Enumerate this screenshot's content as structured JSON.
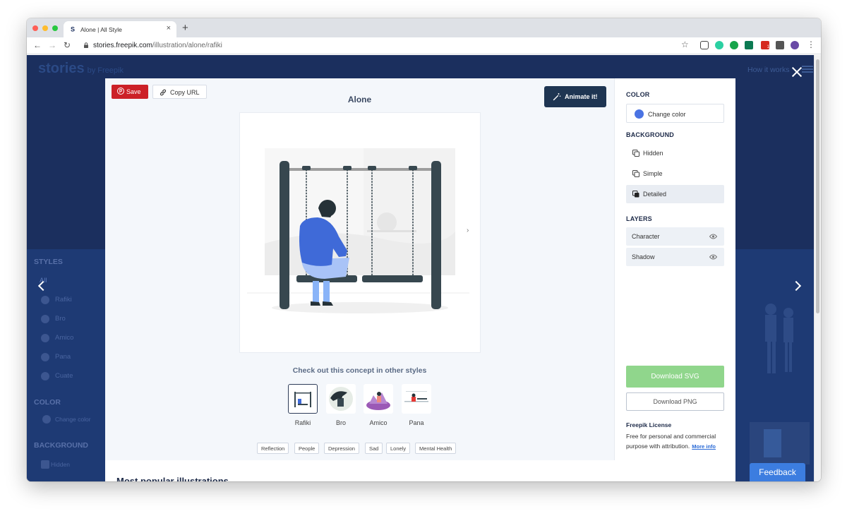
{
  "browser": {
    "tab_title": "Alone | All Style",
    "tab_close": "×",
    "new_tab": "+",
    "url_host": "stories.freepik.com",
    "url_path": "/illustration/alone/rafiki",
    "nav_back": "←",
    "nav_forward": "→",
    "nav_reload": "↻",
    "star": "☆",
    "menu": "⋮",
    "ext_badge": "1"
  },
  "site": {
    "logo": "stories",
    "logo_by": "by Freepik",
    "how_it_works": "How it works"
  },
  "sidebar_bg": {
    "styles_heading": "STYLES",
    "all": "All",
    "styles": [
      "Rafiki",
      "Bro",
      "Amico",
      "Pana",
      "Cuate"
    ],
    "color_heading": "COLOR",
    "change_color": "Change color",
    "background_heading": "BACKGROUND",
    "hidden": "Hidden"
  },
  "modal": {
    "save_label": "Save",
    "copy_url_label": "Copy URL",
    "title": "Alone",
    "animate_label": "Animate it!",
    "other_styles_heading": "Check out this concept in other styles",
    "styles": [
      {
        "label": "Rafiki",
        "selected": true
      },
      {
        "label": "Bro",
        "selected": false
      },
      {
        "label": "Amico",
        "selected": false
      },
      {
        "label": "Pana",
        "selected": false
      }
    ],
    "tags": [
      "Reflection",
      "People",
      "Depression",
      "Sad",
      "Lonely",
      "Mental Health"
    ],
    "bottom_heading": "Most popular illustrations"
  },
  "panel": {
    "color_heading": "COLOR",
    "change_color": "Change color",
    "color_swatch": "#4a73e3",
    "background_heading": "BACKGROUND",
    "background_options": [
      {
        "label": "Hidden",
        "selected": false
      },
      {
        "label": "Simple",
        "selected": false
      },
      {
        "label": "Detailed",
        "selected": true
      }
    ],
    "layers_heading": "LAYERS",
    "layers": [
      {
        "label": "Character",
        "icon": "eye-icon"
      },
      {
        "label": "Shadow",
        "icon": "eye-icon"
      }
    ],
    "download_svg": "Download SVG",
    "download_png": "Download PNG",
    "license_heading": "Freepik License",
    "license_text": "Free for personal and commercial purpose with attribution.",
    "more_info": "More info"
  },
  "feedback_label": "Feedback",
  "colors": {
    "save_red": "#cc2127",
    "animate_navy": "#1e3552",
    "download_green": "#90d68c",
    "feedback_blue": "#3c7de0",
    "page_navy": "#1b2f5e"
  }
}
